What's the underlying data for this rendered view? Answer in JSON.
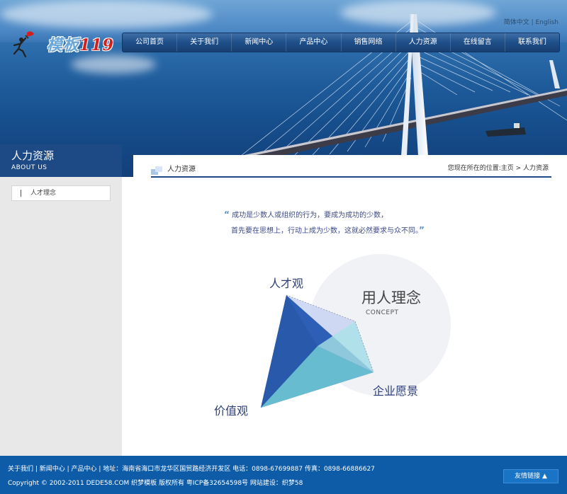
{
  "header": {
    "logo_text": "模板",
    "logo_number": "119",
    "lang_cn": "简体中文",
    "lang_sep": "|",
    "lang_en": "English"
  },
  "nav": [
    {
      "label": "公司首页"
    },
    {
      "label": "关于我们"
    },
    {
      "label": "新闻中心"
    },
    {
      "label": "产品中心"
    },
    {
      "label": "销售网络"
    },
    {
      "label": "人力资源"
    },
    {
      "label": "在线留言"
    },
    {
      "label": "联系我们"
    }
  ],
  "sidebar": {
    "title_cn": "人力资源",
    "title_en": "ABOUT US",
    "items": [
      {
        "label": "人才理念"
      }
    ]
  },
  "main": {
    "section_title": "人力资源",
    "location": "您现在所在的位置:主页 > 人力资源",
    "quote_line1": "成功是少数人或组织的行为，要成为成功的少数，",
    "quote_line2": "首先要在思想上，行动上成为少数，这就必然要求与众不同。",
    "quote_open": "“",
    "quote_close": "”"
  },
  "diagram": {
    "label_talent": "人才观",
    "label_concept_cn": "用人理念",
    "label_concept_en": "CONCEPT",
    "label_vision": "企业愿景",
    "label_values": "价值观"
  },
  "footer": {
    "line1": "关于我们 | 新闻中心 | 产品中心 | 地址：海南省海口市龙华区国贸路经济开发区 电话：0898-67699887 传真：0898-66886627",
    "line2": "Copyright © 2002-2011 DEDE58.COM 织梦模板 版权所有    粤ICP备32654598号 网站建设：织梦58",
    "links_label": "友情链接 ▲"
  },
  "colors": {
    "brand_blue": "#1d4a84",
    "footer_blue": "#0e5ca8",
    "logo_red": "#d21f1f"
  }
}
